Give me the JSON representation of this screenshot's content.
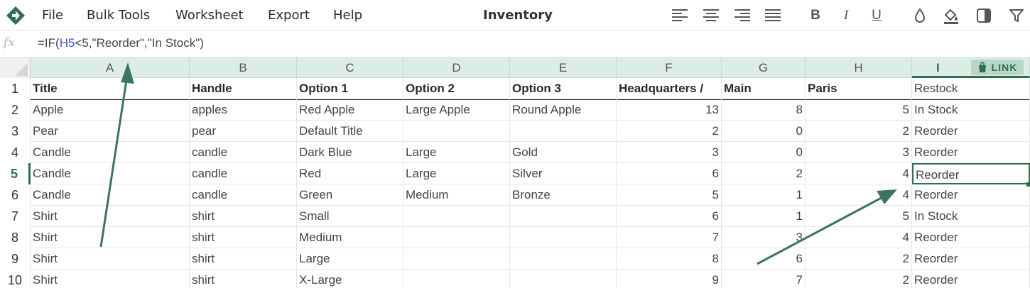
{
  "app": {
    "title": "Inventory",
    "menu": [
      "File",
      "Bulk Tools",
      "Worksheet",
      "Export",
      "Help"
    ],
    "accent_color": "#2f6e52",
    "toolbar_icons": [
      "align-left-icon",
      "align-center-icon",
      "align-right-icon",
      "align-justify-icon",
      "bold-icon",
      "italic-icon",
      "underline-icon",
      "text-color-drop-icon",
      "fill-color-bucket-icon",
      "column-panel-icon",
      "filter-icon"
    ],
    "toolbar_labels": {
      "bold": "B",
      "italic": "I",
      "underline": "U"
    }
  },
  "formula_bar": {
    "fx_label": "fx",
    "prefix": "=IF(",
    "reference": "H5",
    "suffix": "<5,\"Reorder\",\"In Stock\")"
  },
  "columns": [
    "A",
    "B",
    "C",
    "D",
    "E",
    "F",
    "G",
    "H",
    "I"
  ],
  "selected_column": "I",
  "link_badge": "LINK",
  "rows": [
    {
      "n": "1",
      "cells": [
        "Title",
        "Handle",
        "Option 1",
        "Option 2",
        "Option 3",
        "Headquarters /",
        "Main",
        "Paris",
        "Restock"
      ]
    },
    {
      "n": "2",
      "cells": [
        "Apple",
        "apples",
        "Red Apple",
        "Large Apple",
        "Round Apple",
        "13",
        "8",
        "5",
        "In Stock"
      ]
    },
    {
      "n": "3",
      "cells": [
        "Pear",
        "pear",
        "Default Title",
        "",
        "",
        "2",
        "0",
        "2",
        "Reorder"
      ]
    },
    {
      "n": "4",
      "cells": [
        "Candle",
        "candle",
        "Dark Blue",
        "Large",
        "Gold",
        "3",
        "0",
        "3",
        "Reorder"
      ]
    },
    {
      "n": "5",
      "cells": [
        "Candle",
        "candle",
        "Red",
        "Large",
        "Silver",
        "6",
        "2",
        "4",
        "Reorder"
      ]
    },
    {
      "n": "6",
      "cells": [
        "Candle",
        "candle",
        "Green",
        "Medium",
        "Bronze",
        "5",
        "1",
        "4",
        "Reorder"
      ]
    },
    {
      "n": "7",
      "cells": [
        "Shirt",
        "shirt",
        "Small",
        "",
        "",
        "6",
        "1",
        "5",
        "In Stock"
      ]
    },
    {
      "n": "8",
      "cells": [
        "Shirt",
        "shirt",
        "Medium",
        "",
        "",
        "7",
        "3",
        "4",
        "Reorder"
      ]
    },
    {
      "n": "9",
      "cells": [
        "Shirt",
        "shirt",
        "Large",
        "",
        "",
        "8",
        "6",
        "2",
        "Reorder"
      ]
    },
    {
      "n": "10",
      "cells": [
        "Shirt",
        "shirt",
        "X-Large",
        "",
        "",
        "9",
        "7",
        "2",
        "Reorder"
      ]
    }
  ],
  "selected_row": "5",
  "active_cell": "I5"
}
